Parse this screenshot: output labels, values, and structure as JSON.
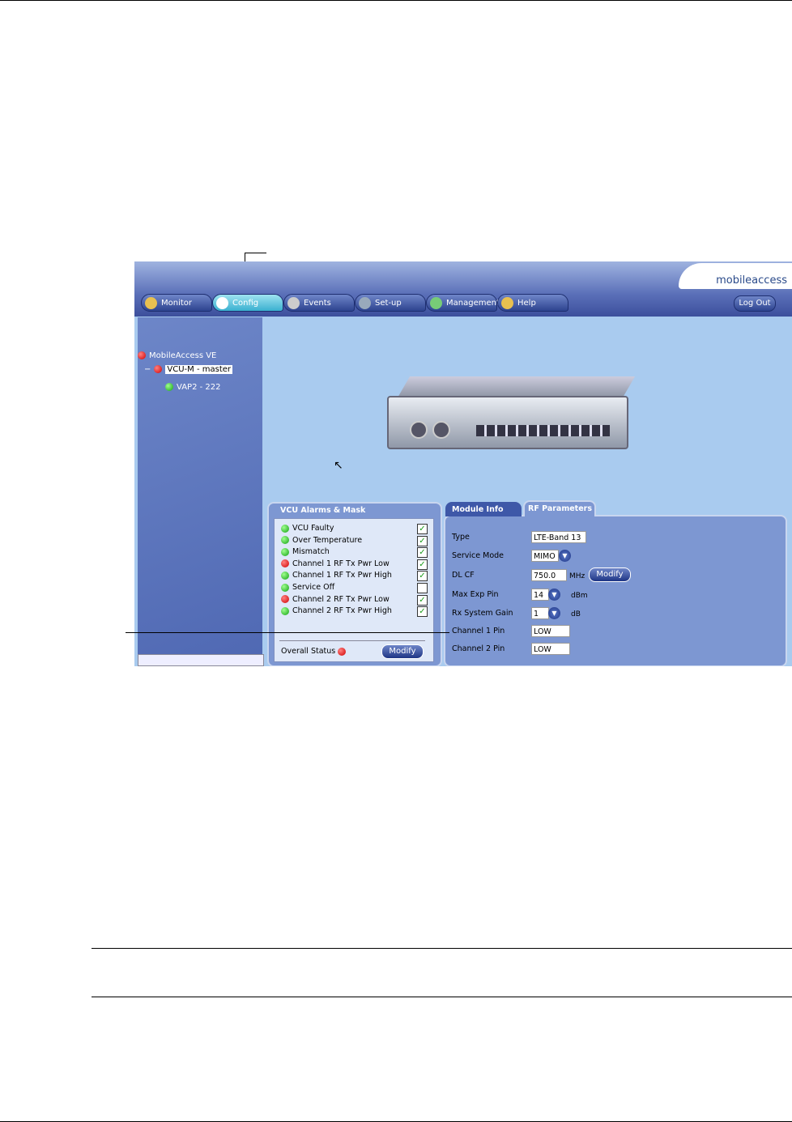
{
  "header": {
    "logo": "mobileaccess",
    "logout": "Log Out"
  },
  "tabs": [
    {
      "label": "Monitor"
    },
    {
      "label": "Config"
    },
    {
      "label": "Events"
    },
    {
      "label": "Set-up"
    },
    {
      "label": "Management"
    },
    {
      "label": "Help"
    }
  ],
  "active_tab": "Config",
  "tree": [
    {
      "label": "MobileAccess VE",
      "status": "red"
    },
    {
      "label": "VCU-M - master",
      "status": "red"
    },
    {
      "label": "VAP2 - 222",
      "status": "green"
    }
  ],
  "alarms": {
    "title": "VCU Alarms & Mask",
    "items": [
      {
        "label": "VCU Faulty",
        "status": "green",
        "mask": true
      },
      {
        "label": "Over Temperature",
        "status": "green",
        "mask": true
      },
      {
        "label": "Mismatch",
        "status": "green",
        "mask": true
      },
      {
        "label": "Channel 1 RF Tx Pwr Low",
        "status": "red",
        "mask": true
      },
      {
        "label": "Channel 1 RF Tx Pwr High",
        "status": "green",
        "mask": true
      },
      {
        "label": "Service Off",
        "status": "green",
        "mask": false
      },
      {
        "label": "Channel 2 RF Tx Pwr Low",
        "status": "red",
        "mask": true
      },
      {
        "label": "Channel 2 RF Tx Pwr High",
        "status": "green",
        "mask": true
      }
    ],
    "overall_label": "Overall Status",
    "overall_status": "red",
    "modify": "Modify"
  },
  "rf": {
    "tabs": [
      "Module Info",
      "RF Parameters"
    ],
    "active": "RF Parameters",
    "type_label": "Type",
    "type": "LTE-Band 13",
    "mode_label": "Service Mode",
    "mode": "MIMO",
    "dlcf_label": "DL CF",
    "dlcf": "750.0",
    "dlcf_unit": "MHz",
    "modify": "Modify",
    "pin_label": "Max Exp Pin",
    "pin": "14",
    "pin_unit": "dBm",
    "gain_label": "Rx System Gain",
    "gain": "1",
    "gain_unit": "dB",
    "ch1_label": "Channel 1 Pin",
    "ch1": "LOW",
    "ch2_label": "Channel 2 Pin",
    "ch2": "LOW"
  }
}
